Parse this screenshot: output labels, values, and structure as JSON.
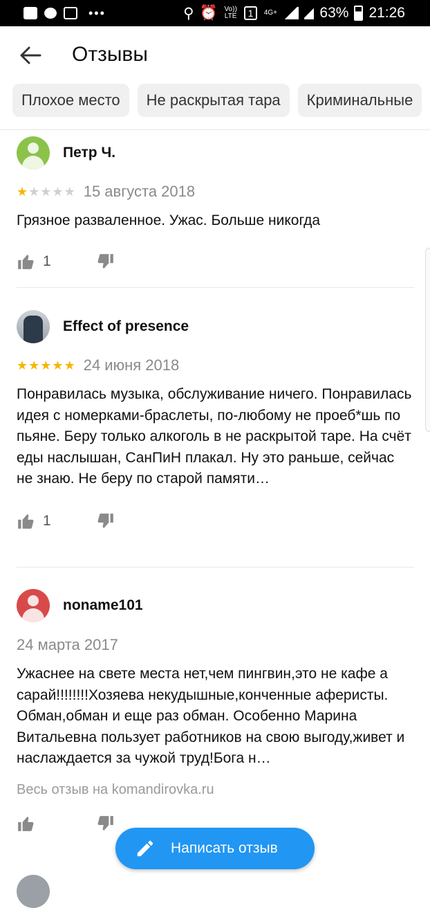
{
  "status_bar": {
    "volte": "Vo)) LTE",
    "sim": "1",
    "net": "4G+",
    "battery": "63%",
    "time": "21:26"
  },
  "header": {
    "title": "Отзывы"
  },
  "chips": [
    {
      "label": "Плохое место"
    },
    {
      "label": "Не раскрытая тара"
    },
    {
      "label": "Криминальные"
    }
  ],
  "reviews": [
    {
      "author": "Петр Ч.",
      "avatar_color": "#8bc34a",
      "rating": 1,
      "date": "15 августа 2018",
      "text": "Грязное разваленное. Ужас. Больше никогда",
      "likes": "1"
    },
    {
      "author": "Effect of presence",
      "rating": 5,
      "date": "24 июня 2018",
      "text": "Понравилась музыка, обслуживание ничего. Понравилась идея с номерками-браслеты, по-любому не проеб*шь по пьяне. Беру только алкоголь в не раскрытой таре. На счёт еды наслышан, СанПиН плакал. Ну это раньше, сейчас не знаю. Не беру по старой памяти…",
      "likes": "1"
    },
    {
      "author": "noname101",
      "avatar_color": "#d84a4a",
      "date": "24 марта 2017",
      "text": "Ужаснее на свете места нет,чем пингвин,это не кафе а сарай!!!!!!!!Хозяева некудышные,конченные аферисты. Обман,обман и еще раз обман. Особенно Марина Витальевна пользует работников на свою выгоду,живет и наслаждается за чужой труд!Бога н…",
      "source": "Весь отзыв на komandirovka.ru"
    }
  ],
  "fab": {
    "label": "Написать отзыв",
    "color": "#2196f3"
  },
  "colors": {
    "star_on": "#f7b500",
    "star_off": "#cfcfcf",
    "chip_bg": "#f0f0f0"
  }
}
